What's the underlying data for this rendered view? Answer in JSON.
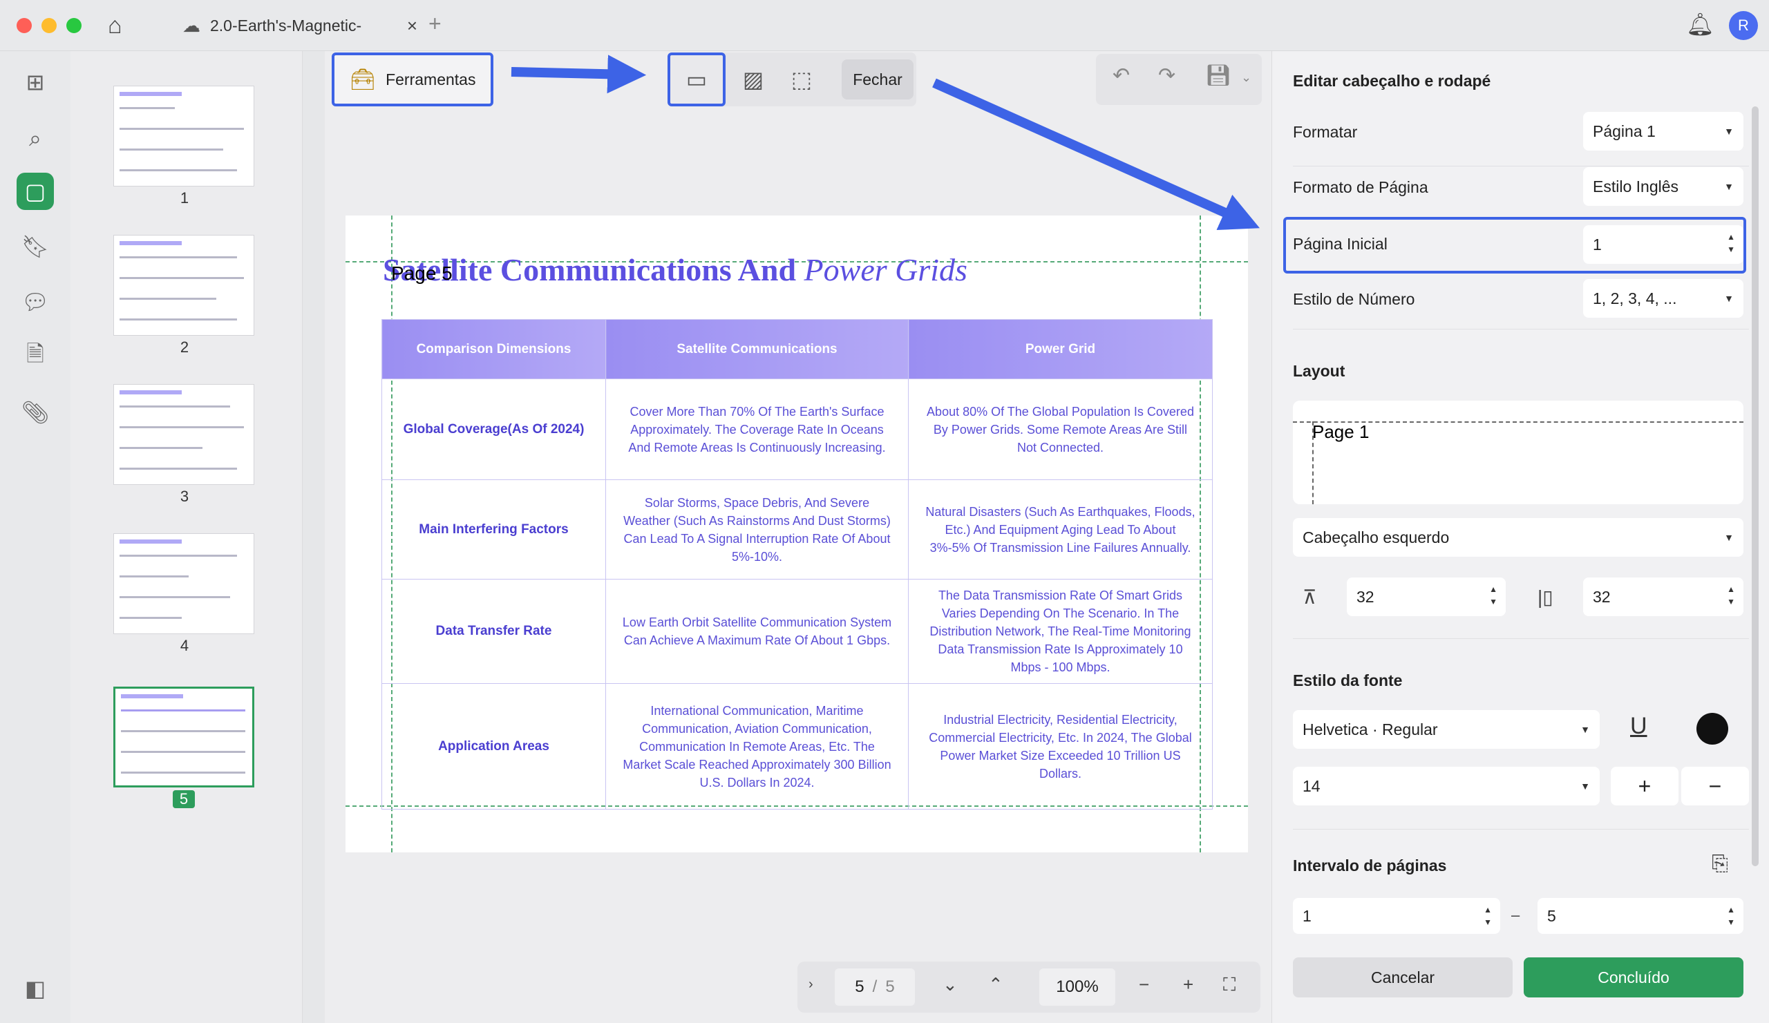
{
  "window": {
    "tab_title": "2.0-Earth's-Magnetic-",
    "avatar_initial": "R",
    "colors": {
      "accent": "#2d9d5c",
      "highlight": "#3d63e6",
      "doc_purple": "#5b4fe0"
    }
  },
  "thumbnails": [
    {
      "label": "1"
    },
    {
      "label": "2"
    },
    {
      "label": "3"
    },
    {
      "label": "4"
    },
    {
      "label": "5"
    }
  ],
  "toolbar": {
    "tools_label": "Ferramentas",
    "close_label": "Fechar"
  },
  "document": {
    "title_bold": "Satellite Communications And",
    "title_italic": "Power Grids",
    "page_label_preview": "Page 5",
    "table": {
      "headers": [
        "Comparison Dimensions",
        "Satellite Communications",
        "Power Grid"
      ],
      "rows": [
        [
          "Global Coverage(As Of 2024)",
          "Cover More Than 70% Of The Earth's Surface Approximately. The Coverage Rate In Oceans And Remote Areas Is Continuously Increasing.",
          "About 80% Of The Global Population Is Covered By Power Grids. Some Remote Areas Are Still Not Connected."
        ],
        [
          "Main Interfering Factors",
          "Solar Storms, Space Debris, And Severe Weather (Such As Rainstorms And Dust Storms) Can Lead To A Signal Interruption Rate Of About 5%-10%.",
          "Natural Disasters (Such As Earthquakes, Floods, Etc.) And Equipment Aging Lead To About 3%-5% Of Transmission Line Failures Annually."
        ],
        [
          "Data Transfer Rate",
          "Low Earth Orbit Satellite Communication System Can Achieve A Maximum Rate Of About 1 Gbps.",
          "The Data Transmission Rate Of Smart Grids Varies Depending On The Scenario. In The Distribution Network, The Real-Time Monitoring Data Transmission Rate Is Approximately 10 Mbps - 100 Mbps."
        ],
        [
          "Application Areas",
          "International Communication, Maritime Communication, Aviation Communication, Communication In Remote Areas, Etc. The Market Scale Reached Approximately 300 Billion U.S. Dollars In 2024.",
          "Industrial Electricity, Residential Electricity, Commercial Electricity, Etc. In 2024, The Global Power Market Size Exceeded 10 Trillion US Dollars."
        ]
      ]
    }
  },
  "pager": {
    "current_page": "5",
    "separator": "/",
    "total_pages": "5",
    "zoom": "100%"
  },
  "panel": {
    "title": "Editar cabeçalho e rodapé",
    "format_label": "Formatar",
    "format_value": "Página 1",
    "page_format_label": "Formato de Página",
    "page_format_value": "Estilo Inglês",
    "start_page_label": "Página Inicial",
    "start_page_value": "1",
    "number_style_label": "Estilo de Número",
    "number_style_value": "1, 2, 3, 4, ...",
    "layout_title": "Layout",
    "layout_preview_text": "Page 1",
    "position_value": "Cabeçalho esquerdo",
    "margin_top": "32",
    "margin_side": "32",
    "font_style_title": "Estilo da fonte",
    "font_value": "Helvetica · Regular",
    "font_size": "14",
    "font_color": "#111111",
    "page_range_title": "Intervalo de páginas",
    "range_from": "1",
    "range_dash": "–",
    "range_to": "5",
    "cancel_label": "Cancelar",
    "done_label": "Concluído"
  }
}
